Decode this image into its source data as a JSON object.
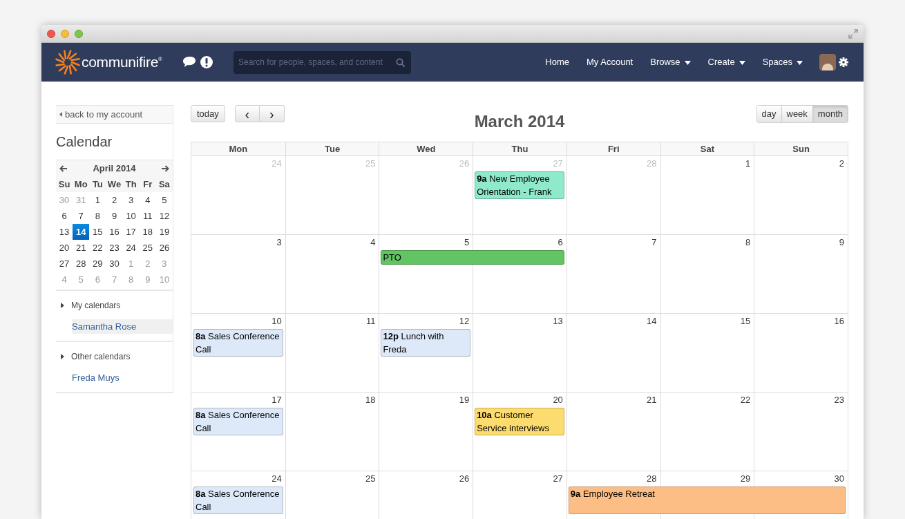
{
  "logo": {
    "name": "communifire",
    "mark": "®"
  },
  "nav": {
    "search_placeholder": "Search for people, spaces, and content",
    "links": [
      {
        "label": "Home",
        "dropdown": false
      },
      {
        "label": "My Account",
        "dropdown": false
      },
      {
        "label": "Browse",
        "dropdown": true
      },
      {
        "label": "Create",
        "dropdown": true
      },
      {
        "label": "Spaces",
        "dropdown": true
      }
    ]
  },
  "sidebar": {
    "back_link": "back to my account",
    "title": "Calendar",
    "mini_calendar": {
      "month": "April 2014",
      "weekdays": [
        "Su",
        "Mo",
        "Tu",
        "We",
        "Th",
        "Fr",
        "Sa"
      ],
      "weeks": [
        [
          {
            "d": "30",
            "other_month": true,
            "selected": false
          },
          {
            "d": "31",
            "other_month": true,
            "selected": false
          },
          {
            "d": "1",
            "other_month": false,
            "selected": false
          },
          {
            "d": "2",
            "other_month": false,
            "selected": false
          },
          {
            "d": "3",
            "other_month": false,
            "selected": false
          },
          {
            "d": "4",
            "other_month": false,
            "selected": false
          },
          {
            "d": "5",
            "other_month": false,
            "selected": false
          }
        ],
        [
          {
            "d": "6",
            "other_month": false,
            "selected": false
          },
          {
            "d": "7",
            "other_month": false,
            "selected": false
          },
          {
            "d": "8",
            "other_month": false,
            "selected": false
          },
          {
            "d": "9",
            "other_month": false,
            "selected": false
          },
          {
            "d": "10",
            "other_month": false,
            "selected": false
          },
          {
            "d": "11",
            "other_month": false,
            "selected": false
          },
          {
            "d": "12",
            "other_month": false,
            "selected": false
          }
        ],
        [
          {
            "d": "13",
            "other_month": false,
            "selected": false
          },
          {
            "d": "14",
            "other_month": false,
            "selected": true
          },
          {
            "d": "15",
            "other_month": false,
            "selected": false
          },
          {
            "d": "16",
            "other_month": false,
            "selected": false
          },
          {
            "d": "17",
            "other_month": false,
            "selected": false
          },
          {
            "d": "18",
            "other_month": false,
            "selected": false
          },
          {
            "d": "19",
            "other_month": false,
            "selected": false
          }
        ],
        [
          {
            "d": "20",
            "other_month": false,
            "selected": false
          },
          {
            "d": "21",
            "other_month": false,
            "selected": false
          },
          {
            "d": "22",
            "other_month": false,
            "selected": false
          },
          {
            "d": "23",
            "other_month": false,
            "selected": false
          },
          {
            "d": "24",
            "other_month": false,
            "selected": false
          },
          {
            "d": "25",
            "other_month": false,
            "selected": false
          },
          {
            "d": "26",
            "other_month": false,
            "selected": false
          }
        ],
        [
          {
            "d": "27",
            "other_month": false,
            "selected": false
          },
          {
            "d": "28",
            "other_month": false,
            "selected": false
          },
          {
            "d": "29",
            "other_month": false,
            "selected": false
          },
          {
            "d": "30",
            "other_month": false,
            "selected": false
          },
          {
            "d": "1",
            "other_month": true,
            "selected": false
          },
          {
            "d": "2",
            "other_month": true,
            "selected": false
          },
          {
            "d": "3",
            "other_month": true,
            "selected": false
          }
        ],
        [
          {
            "d": "4",
            "other_month": true,
            "selected": false
          },
          {
            "d": "5",
            "other_month": true,
            "selected": false
          },
          {
            "d": "6",
            "other_month": true,
            "selected": false
          },
          {
            "d": "7",
            "other_month": true,
            "selected": false
          },
          {
            "d": "8",
            "other_month": true,
            "selected": false
          },
          {
            "d": "9",
            "other_month": true,
            "selected": false
          },
          {
            "d": "10",
            "other_month": true,
            "selected": false
          }
        ]
      ]
    },
    "sections": [
      {
        "title": "My calendars",
        "items": [
          {
            "label": "Samantha Rose",
            "selected": true
          }
        ]
      },
      {
        "title": "Other calendars",
        "items": [
          {
            "label": "Freda Muys",
            "selected": false
          }
        ]
      }
    ]
  },
  "toolbar": {
    "today": "today",
    "prev": "‹",
    "next": "›",
    "title": "March 2014",
    "views": [
      {
        "label": "day",
        "selected": false
      },
      {
        "label": "week",
        "selected": false
      },
      {
        "label": "month",
        "selected": true
      }
    ]
  },
  "calendar": {
    "weekdays": [
      "Mon",
      "Tue",
      "Wed",
      "Thu",
      "Fri",
      "Sat",
      "Sun"
    ],
    "weeks": [
      {
        "days": [
          {
            "d": "24",
            "other_month": true
          },
          {
            "d": "25",
            "other_month": true
          },
          {
            "d": "26",
            "other_month": true
          },
          {
            "d": "27",
            "other_month": true,
            "events": [
              {
                "time": "9a",
                "title": "New Employee Orientation - Frank",
                "color": "#8eeacb"
              }
            ]
          },
          {
            "d": "28",
            "other_month": true
          },
          {
            "d": "1",
            "other_month": false
          },
          {
            "d": "2",
            "other_month": false
          }
        ]
      },
      {
        "days": [
          {
            "d": "3",
            "other_month": false
          },
          {
            "d": "4",
            "other_month": false
          },
          {
            "d": "5",
            "other_month": false,
            "events": [
              {
                "title": "PTO",
                "color": "#62c462"
              }
            ]
          },
          {
            "d": "6",
            "other_month": false,
            "continued": true
          },
          {
            "d": "7",
            "other_month": false
          },
          {
            "d": "8",
            "other_month": false
          },
          {
            "d": "9",
            "other_month": false
          }
        ]
      },
      {
        "days": [
          {
            "d": "10",
            "other_month": false,
            "events": [
              {
                "time": "8a",
                "title": "Sales Conference Call",
                "color": "#dde9f9"
              }
            ]
          },
          {
            "d": "11",
            "other_month": false
          },
          {
            "d": "12",
            "other_month": false,
            "events": [
              {
                "time": "12p",
                "title": "Lunch with Freda",
                "color": "#dde9f9"
              }
            ]
          },
          {
            "d": "13",
            "other_month": false
          },
          {
            "d": "14",
            "other_month": false
          },
          {
            "d": "15",
            "other_month": false
          },
          {
            "d": "16",
            "other_month": false
          }
        ]
      },
      {
        "days": [
          {
            "d": "17",
            "other_month": false,
            "events": [
              {
                "time": "8a",
                "title": "Sales Conference Call",
                "color": "#dde9f9"
              }
            ]
          },
          {
            "d": "18",
            "other_month": false
          },
          {
            "d": "19",
            "other_month": false
          },
          {
            "d": "20",
            "other_month": false,
            "events": [
              {
                "time": "10a",
                "title": "Customer Service interviews",
                "color": "#fddc6f"
              }
            ]
          },
          {
            "d": "21",
            "other_month": false
          },
          {
            "d": "22",
            "other_month": false
          },
          {
            "d": "23",
            "other_month": false
          }
        ]
      },
      {
        "days": [
          {
            "d": "24",
            "other_month": false,
            "events": [
              {
                "time": "8a",
                "title": "Sales Conference Call",
                "color": "#dde9f9"
              }
            ]
          },
          {
            "d": "25",
            "other_month": false
          },
          {
            "d": "26",
            "other_month": false
          },
          {
            "d": "27",
            "other_month": false
          },
          {
            "d": "28",
            "other_month": false,
            "events": [
              {
                "time": "9a",
                "title": "Employee Retreat",
                "color": "#fdbe85"
              }
            ]
          },
          {
            "d": "29",
            "other_month": false,
            "continued": true
          },
          {
            "d": "30",
            "other_month": false,
            "continued": true
          }
        ]
      }
    ]
  }
}
